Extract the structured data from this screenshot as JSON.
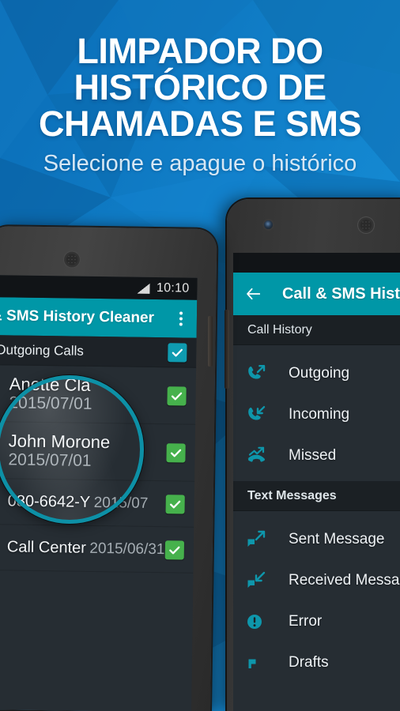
{
  "hero": {
    "title_lines": [
      "LIMPADOR DO",
      "HISTÓRICO DE",
      "CHAMADAS E SMS"
    ],
    "subtitle": "Selecione e apague o histórico",
    "bg_color": "#0a6bb3",
    "accent_color": "#0097a7"
  },
  "left_phone": {
    "status_bar": {
      "time": "10:10",
      "signal_icon": "signal-triangle-icon"
    },
    "app_bar": {
      "title": "Call & SMS History Cleaner",
      "overflow_icon": "kebab-menu-icon"
    },
    "group_header": {
      "label": "Outgoing Calls",
      "checked": true,
      "checkbox_color": "#0f9bb0"
    },
    "calls": [
      {
        "name": "Anette Cla",
        "date": "2015/07/01",
        "icon": "outgoing-call-icon",
        "checked": true
      },
      {
        "name": "John Morone",
        "date": "2015/07/01",
        "icon": "outgoing-call-icon",
        "checked": true
      },
      {
        "name": "080-6642-Y",
        "date": "2015/07",
        "icon": "outgoing-call-icon",
        "checked": true
      },
      {
        "name": "Call Center",
        "date": "2015/06/31",
        "icon": "outgoing-call-icon",
        "checked": true
      }
    ],
    "checkbox_color": "#46b14c",
    "magnifier": {
      "name": "magnifier-lens",
      "ring_color": "#0d90a6"
    }
  },
  "right_phone": {
    "app_bar": {
      "back_icon": "back-arrow-icon",
      "title": "Call & SMS History"
    },
    "sections": [
      {
        "header": "Call History",
        "bold": false,
        "items": [
          {
            "label": "Outgoing",
            "icon": "outgoing-call-icon"
          },
          {
            "label": "Incoming",
            "icon": "incoming-call-icon"
          },
          {
            "label": "Missed",
            "icon": "missed-call-icon"
          }
        ]
      },
      {
        "header": "Text Messages",
        "bold": true,
        "items": [
          {
            "label": "Sent Message",
            "icon": "sent-message-icon"
          },
          {
            "label": "Received Message",
            "icon": "received-message-icon"
          },
          {
            "label": "Error",
            "icon": "error-icon"
          },
          {
            "label": "Drafts",
            "icon": "drafts-flag-icon"
          }
        ]
      }
    ],
    "icon_color": "#0e96ab"
  }
}
